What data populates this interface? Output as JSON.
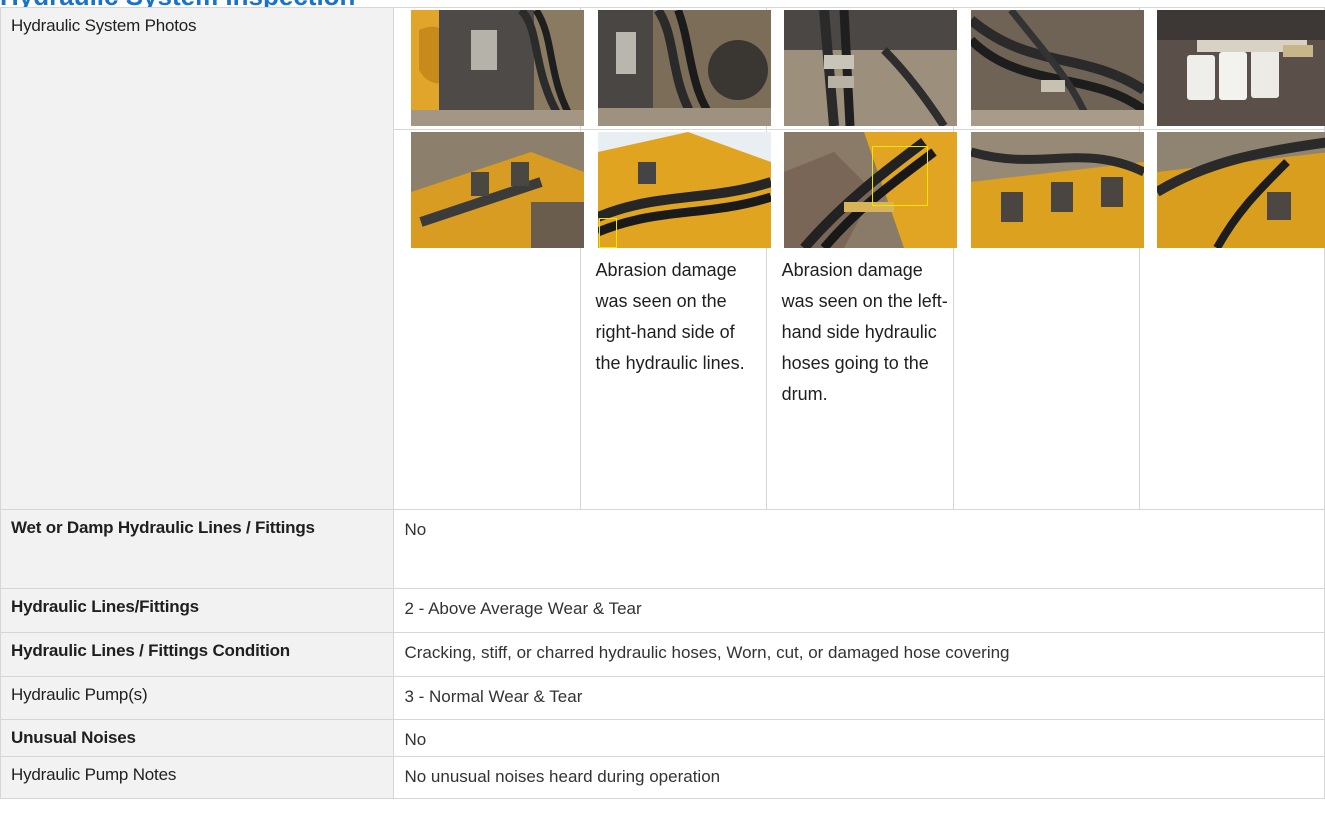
{
  "section_title": "Hydraulic System Inspection",
  "photos": {
    "label": "Hydraulic System Photos",
    "row1": [
      {
        "icon": "photo-hydraulic-bracket"
      },
      {
        "icon": "photo-hydraulic-bracket-hoses"
      },
      {
        "icon": "photo-hydraulic-fittings"
      },
      {
        "icon": "photo-hydraulic-lines-underside"
      },
      {
        "icon": "photo-hydraulic-filters"
      }
    ],
    "row2": [
      {
        "icon": "photo-scraper-frame",
        "caption": ""
      },
      {
        "icon": "photo-right-side-hoses",
        "caption": "Abrasion damage was seen on the right-hand side of the hydraulic lines."
      },
      {
        "icon": "photo-left-side-hoses",
        "caption": "Abrasion damage was seen on the left-hand side hydraulic hoses going to the drum."
      },
      {
        "icon": "photo-drum-pads",
        "caption": ""
      },
      {
        "icon": "photo-drum-hoses",
        "caption": ""
      }
    ]
  },
  "rows": [
    {
      "label": "Wet or Damp Hydraulic Lines / Fittings",
      "value": "No"
    },
    {
      "label": "Hydraulic Lines/Fittings",
      "value": "2 - Above Average Wear & Tear"
    },
    {
      "label": "Hydraulic Lines / Fittings Condition",
      "value": "Cracking, stiff, or charred hydraulic hoses, Worn, cut, or damaged hose covering"
    },
    {
      "label": "Hydraulic Pump(s)",
      "value": "3 - Normal Wear & Tear"
    },
    {
      "label": "Unusual Noises",
      "value": "No"
    },
    {
      "label": "Hydraulic Pump Notes",
      "value": "No unusual noises heard during operation"
    }
  ],
  "colors": {
    "accent": "#1a73c8",
    "label_bg": "#f2f2f2",
    "border": "#d6d6d6",
    "machine_yellow": "#e3a81e",
    "highlight": "#f2e600"
  }
}
